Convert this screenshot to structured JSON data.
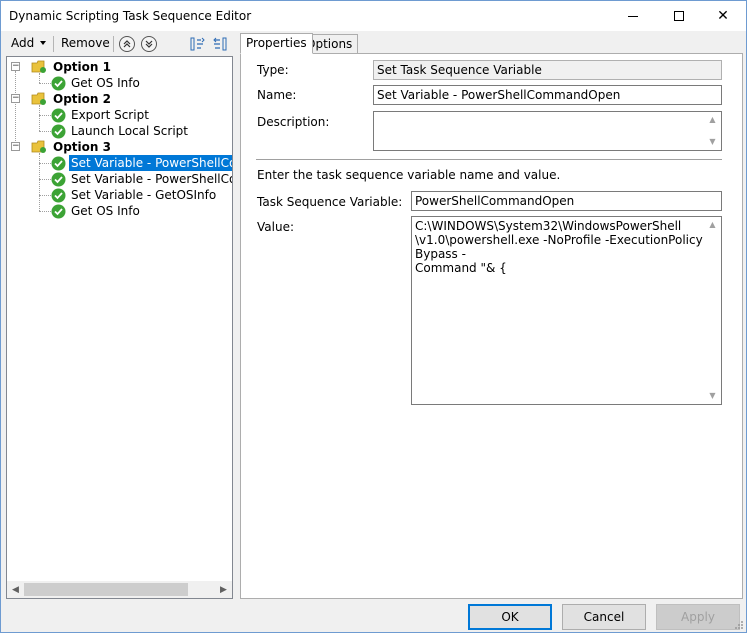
{
  "window": {
    "title": "Dynamic Scripting Task Sequence Editor",
    "controls": {
      "minimize": "—",
      "maximize": "☐",
      "close": "✕"
    }
  },
  "toolbar": {
    "add_label": "Add",
    "remove_label": "Remove",
    "move_up_icon": "⌃",
    "move_down_icon": "⌄"
  },
  "tree": {
    "groups": [
      {
        "label": "Option 1",
        "expander": "−",
        "children": [
          "Get OS Info"
        ]
      },
      {
        "label": "Option 2",
        "expander": "−",
        "children": [
          "Export Script",
          "Launch Local Script"
        ]
      },
      {
        "label": "Option 3",
        "expander": "−",
        "children": [
          "Set Variable - PowerShellCommandOpen",
          "Set Variable - PowerShellCommandClose",
          "Set Variable - GetOSInfo",
          "Get OS Info"
        ]
      }
    ],
    "selected": "Set Variable - PowerShellCommandOpen"
  },
  "tabs": [
    {
      "label": "Properties",
      "active": true
    },
    {
      "label": "Options",
      "active": false
    }
  ],
  "properties": {
    "type_label": "Type:",
    "type_value": "Set Task Sequence Variable",
    "name_label": "Name:",
    "name_value": "Set Variable - PowerShellCommandOpen",
    "description_label": "Description:",
    "description_value": "",
    "instructions": "Enter the task sequence variable name and value.",
    "variable_label": "Task Sequence Variable:",
    "variable_value": "PowerShellCommandOpen",
    "value_label": "Value:",
    "value_lines": [
      "C:\\WINDOWS\\System32\\WindowsPowerShell",
      "\\v1.0\\powershell.exe -NoProfile -ExecutionPolicy Bypass -",
      "Command \"& {"
    ]
  },
  "buttons": {
    "ok": "OK",
    "cancel": "Cancel",
    "apply": "Apply"
  },
  "colors": {
    "selection": "#0078d7",
    "check_green": "#3ca335",
    "folder_yellow": "#e9c23c"
  }
}
